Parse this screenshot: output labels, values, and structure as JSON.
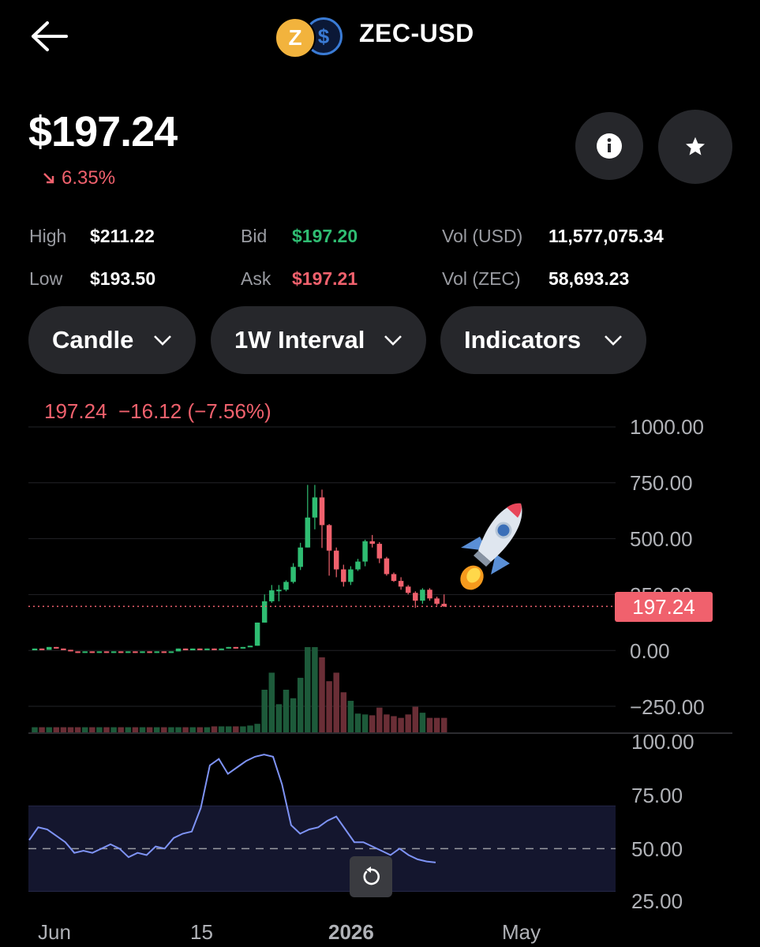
{
  "header": {
    "back_icon": "arrow-left-icon",
    "pair": "ZEC-USD",
    "coins": [
      "ZEC",
      "USD"
    ],
    "coin_zec_symbol": "Z",
    "coin_usd_symbol": "$"
  },
  "price": {
    "current": "$197.24",
    "change_pct": "6.35%",
    "change_direction": "down"
  },
  "actions": {
    "info_icon": "info-icon",
    "favorite_icon": "star-icon"
  },
  "stats": {
    "high": {
      "label": "High",
      "value": "$211.22"
    },
    "low": {
      "label": "Low",
      "value": "$193.50"
    },
    "bid": {
      "label": "Bid",
      "value": "$197.20"
    },
    "ask": {
      "label": "Ask",
      "value": "$197.21"
    },
    "vol_usd": {
      "label": "Vol (USD)",
      "value": "11,577,075.34"
    },
    "vol_zec": {
      "label": "Vol (ZEC)",
      "value": "58,693.23"
    }
  },
  "controls": {
    "chart_type": "Candle",
    "interval": "1W Interval",
    "indicators": "Indicators"
  },
  "chart": {
    "ohlc_readout": {
      "price": "197.24",
      "change": "−16.12 (−7.56%)"
    },
    "price_axis": [
      "1000.00",
      "750.00",
      "500.00",
      "250.00",
      "0.00",
      "−250.00"
    ],
    "current_price_tag": "197.24",
    "rsi_axis": [
      "100.00",
      "75.00",
      "50.00",
      "25.00"
    ],
    "date_labels": [
      "Jun",
      "15",
      "2026",
      "May"
    ],
    "colors": {
      "up": "#2fbd72",
      "down": "#f0616d",
      "rsi_line": "#7e93f5",
      "rsi_band": "#14162e"
    }
  },
  "chart_data": {
    "type": "candlestick",
    "title": "",
    "y_range": [
      -250,
      1000
    ],
    "candles": [
      {
        "o": 0.7,
        "c": 8.4,
        "h": 8.4,
        "l": 0.7
      },
      {
        "o": 8.4,
        "c": 2.8,
        "h": 8.4,
        "l": 2.8
      },
      {
        "o": 2.8,
        "c": 15.4,
        "h": 15.4,
        "l": 2.8
      },
      {
        "o": 15.4,
        "c": 8.4,
        "h": 15.4,
        "l": 8.4
      },
      {
        "o": 8.4,
        "c": 2.8,
        "h": 8.4,
        "l": 2.8
      },
      {
        "o": 2.8,
        "c": -4.2,
        "h": 2.8,
        "l": -4.2
      },
      {
        "o": -4.2,
        "c": -11.2,
        "h": -4.2,
        "l": -11.2
      },
      {
        "o": -11.2,
        "c": -4.2,
        "h": -4.2,
        "l": -11.2
      },
      {
        "o": -4.2,
        "c": -11.2,
        "h": -4.2,
        "l": -11.2
      },
      {
        "o": -11.2,
        "c": -4.2,
        "h": -4.2,
        "l": -11.2
      },
      {
        "o": -4.2,
        "c": -11.2,
        "h": -4.2,
        "l": -11.2
      },
      {
        "o": -11.2,
        "c": -4.2,
        "h": -4.2,
        "l": -11.2
      },
      {
        "o": -4.2,
        "c": -11.2,
        "h": -4.2,
        "l": -11.2
      },
      {
        "o": -11.2,
        "c": -4.2,
        "h": -4.2,
        "l": -11.2
      },
      {
        "o": -4.2,
        "c": -11.2,
        "h": -4.2,
        "l": -11.2
      },
      {
        "o": -11.2,
        "c": -4.2,
        "h": -4.2,
        "l": -11.2
      },
      {
        "o": -4.2,
        "c": -11.2,
        "h": -4.2,
        "l": -11.2
      },
      {
        "o": -11.2,
        "c": -4.2,
        "h": -4.2,
        "l": -11.2
      },
      {
        "o": -4.2,
        "c": -11.2,
        "h": -4.2,
        "l": -11.2
      },
      {
        "o": -11.2,
        "c": -4.2,
        "h": -4.2,
        "l": -11.2
      },
      {
        "o": -4.2,
        "c": 8.4,
        "h": 8.4,
        "l": -4.2
      },
      {
        "o": 8.4,
        "c": 0.7,
        "h": 8.4,
        "l": 0.7
      },
      {
        "o": 0.7,
        "c": 8.4,
        "h": 8.4,
        "l": 0.7
      },
      {
        "o": 8.4,
        "c": 2.8,
        "h": 8.4,
        "l": 2.8
      },
      {
        "o": 2.8,
        "c": 8.4,
        "h": 8.4,
        "l": 2.8
      },
      {
        "o": 8.4,
        "c": 2.8,
        "h": 8.4,
        "l": 2.8
      },
      {
        "o": 2.8,
        "c": 8.4,
        "h": 8.4,
        "l": 2.8
      },
      {
        "o": 8.4,
        "c": 15.4,
        "h": 15.4,
        "l": 8.4
      },
      {
        "o": 15.4,
        "c": 8.4,
        "h": 15.4,
        "l": 8.4
      },
      {
        "o": 8.4,
        "c": 15.4,
        "h": 15.4,
        "l": 8.4
      },
      {
        "o": 15.4,
        "c": 21.0,
        "h": 21.0,
        "l": 15.4
      },
      {
        "o": 21.0,
        "c": 124.6,
        "h": 124.6,
        "l": 21.0
      },
      {
        "o": 124.6,
        "c": 219.8,
        "h": 250.6,
        "l": 124.6
      },
      {
        "o": 219.8,
        "c": 268.8,
        "h": 292.6,
        "l": 212.8
      },
      {
        "o": 268.8,
        "c": 271.6,
        "h": 292.6,
        "l": 219.8
      },
      {
        "o": 271.6,
        "c": 306.6,
        "h": 313.6,
        "l": 264.6
      },
      {
        "o": 306.6,
        "c": 373.8,
        "h": 390.6,
        "l": 299.6
      },
      {
        "o": 373.8,
        "c": 460.6,
        "h": 481.6,
        "l": 359.8
      },
      {
        "o": 460.6,
        "c": 594.6,
        "h": 740.6,
        "l": 460.6
      },
      {
        "o": 594.6,
        "c": 684.6,
        "h": 740.6,
        "l": 541.8
      },
      {
        "o": 684.6,
        "c": 560.7,
        "h": 719.6,
        "l": 458.5
      },
      {
        "o": 560.7,
        "c": 446.6,
        "h": 565.6,
        "l": 334.6
      },
      {
        "o": 446.6,
        "c": 362.6,
        "h": 460.6,
        "l": 327.6
      },
      {
        "o": 362.6,
        "c": 306.6,
        "h": 383.6,
        "l": 285.6
      },
      {
        "o": 306.6,
        "c": 362.6,
        "h": 376.6,
        "l": 292.6
      },
      {
        "o": 362.6,
        "c": 397.6,
        "h": 409.6,
        "l": 355.6
      },
      {
        "o": 397.6,
        "c": 488.6,
        "h": 495.6,
        "l": 376.6
      },
      {
        "o": 488.6,
        "c": 477.0,
        "h": 516.6,
        "l": 460.6
      },
      {
        "o": 477.0,
        "c": 411.6,
        "h": 484.6,
        "l": 390.6
      },
      {
        "o": 411.6,
        "c": 341.6,
        "h": 418.6,
        "l": 334.6
      },
      {
        "o": 341.6,
        "c": 311.0,
        "h": 348.6,
        "l": 306.6
      },
      {
        "o": 311.0,
        "c": 285.6,
        "h": 327.6,
        "l": 271.6
      },
      {
        "o": 285.6,
        "c": 257.6,
        "h": 292.6,
        "l": 250.6
      },
      {
        "o": 257.6,
        "c": 222.6,
        "h": 264.6,
        "l": 190.6
      },
      {
        "o": 222.6,
        "c": 271.6,
        "h": 278.6,
        "l": 208.6
      },
      {
        "o": 271.6,
        "c": 232.6,
        "h": 278.6,
        "l": 222.6
      },
      {
        "o": 232.6,
        "c": 208.6,
        "h": 240.6,
        "l": 201.6
      },
      {
        "o": 208.6,
        "c": 197.24,
        "h": 250.6,
        "l": 194.6
      }
    ],
    "volume_relative": [
      0.06,
      0.06,
      0.06,
      0.06,
      0.06,
      0.06,
      0.06,
      0.06,
      0.06,
      0.06,
      0.06,
      0.06,
      0.06,
      0.06,
      0.06,
      0.06,
      0.06,
      0.06,
      0.06,
      0.06,
      0.06,
      0.06,
      0.06,
      0.06,
      0.06,
      0.07,
      0.07,
      0.07,
      0.07,
      0.07,
      0.08,
      0.1,
      0.5,
      0.7,
      0.33,
      0.5,
      0.4,
      0.64,
      1.0,
      1.0,
      0.88,
      0.6,
      0.7,
      0.47,
      0.37,
      0.22,
      0.21,
      0.2,
      0.29,
      0.21,
      0.19,
      0.17,
      0.21,
      0.3,
      0.23,
      0.17,
      0.17,
      0.17
    ],
    "rsi": [
      {
        "x": 0,
        "y": 54
      },
      {
        "x": 1,
        "y": 60
      },
      {
        "x": 2,
        "y": 59
      },
      {
        "x": 3,
        "y": 56
      },
      {
        "x": 4,
        "y": 53
      },
      {
        "x": 5,
        "y": 48
      },
      {
        "x": 6,
        "y": 49
      },
      {
        "x": 7,
        "y": 48
      },
      {
        "x": 8,
        "y": 50
      },
      {
        "x": 9,
        "y": 52
      },
      {
        "x": 10,
        "y": 50
      },
      {
        "x": 11,
        "y": 46
      },
      {
        "x": 12,
        "y": 48
      },
      {
        "x": 13,
        "y": 47
      },
      {
        "x": 14,
        "y": 51
      },
      {
        "x": 15,
        "y": 50
      },
      {
        "x": 16,
        "y": 55
      },
      {
        "x": 17,
        "y": 57
      },
      {
        "x": 18,
        "y": 58
      },
      {
        "x": 19,
        "y": 69
      },
      {
        "x": 20,
        "y": 89
      },
      {
        "x": 21,
        "y": 92
      },
      {
        "x": 22,
        "y": 85
      },
      {
        "x": 23,
        "y": 88
      },
      {
        "x": 24,
        "y": 91
      },
      {
        "x": 25,
        "y": 93
      },
      {
        "x": 26,
        "y": 94
      },
      {
        "x": 27,
        "y": 93
      },
      {
        "x": 28,
        "y": 80
      },
      {
        "x": 29,
        "y": 61
      },
      {
        "x": 30,
        "y": 57
      },
      {
        "x": 31,
        "y": 59
      },
      {
        "x": 32,
        "y": 60
      },
      {
        "x": 33,
        "y": 63
      },
      {
        "x": 34,
        "y": 65
      },
      {
        "x": 35,
        "y": 59
      },
      {
        "x": 36,
        "y": 53
      },
      {
        "x": 37,
        "y": 53
      },
      {
        "x": 38,
        "y": 51
      },
      {
        "x": 39,
        "y": 49
      },
      {
        "x": 40,
        "y": 47
      },
      {
        "x": 41,
        "y": 50
      },
      {
        "x": 42,
        "y": 47
      },
      {
        "x": 43,
        "y": 45
      },
      {
        "x": 44,
        "y": 44
      },
      {
        "x": 45,
        "y": 43.5
      }
    ],
    "rsi_range": [
      25,
      100
    ],
    "rsi_band": [
      30,
      70
    ]
  }
}
